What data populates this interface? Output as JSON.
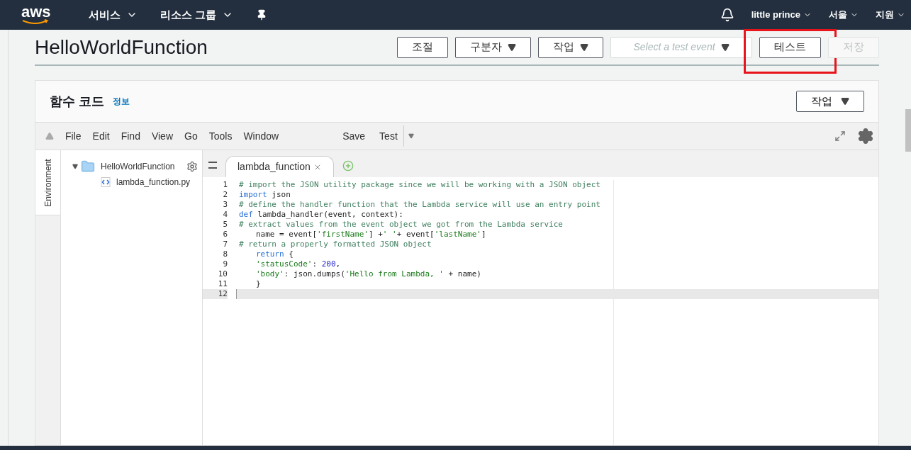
{
  "nav": {
    "logo": "aws",
    "menus": [
      {
        "label": "서비스"
      },
      {
        "label": "리소스 그룹"
      }
    ],
    "right": [
      {
        "label": "little prince"
      },
      {
        "label": "서울"
      },
      {
        "label": "지원"
      }
    ]
  },
  "header": {
    "title": "HelloWorldFunction",
    "buttons": [
      {
        "label": "조절",
        "kind": "plain",
        "disabled": false,
        "highlighted": false
      },
      {
        "label": "구분자",
        "kind": "dropdown",
        "disabled": false,
        "highlighted": false
      },
      {
        "label": "작업",
        "kind": "dropdown",
        "disabled": false,
        "highlighted": false
      },
      {
        "placeholder": "Select a test event",
        "kind": "select",
        "highlighted": false
      },
      {
        "label": "테스트",
        "kind": "plain",
        "disabled": false,
        "highlighted": true
      },
      {
        "label": "저장",
        "kind": "plain",
        "disabled": true,
        "highlighted": false
      }
    ]
  },
  "panel": {
    "title": "함수 코드",
    "info_link": "정보",
    "action_button": "작업"
  },
  "ide": {
    "menu": [
      "File",
      "Edit",
      "Find",
      "View",
      "Go",
      "Tools",
      "Window"
    ],
    "save": "Save",
    "test": "Test",
    "side_tab": "Environment",
    "tree": [
      {
        "label": "HelloWorldFunction",
        "kind": "folder",
        "expanded": true,
        "children": [
          {
            "label": "lambda_function.py",
            "kind": "file"
          }
        ]
      }
    ],
    "tabs": [
      {
        "label": "lambda_function",
        "selected": true
      }
    ],
    "lines": [
      {
        "n": "1",
        "tokens": [
          {
            "kind": "comment",
            "text": "# import the JSON utility package since we will be working with a JSON object"
          }
        ]
      },
      {
        "n": "2",
        "tokens": [
          {
            "kind": "keyword",
            "text": "import"
          },
          {
            "kind": "plain",
            "text": " json"
          }
        ]
      },
      {
        "n": "3",
        "tokens": [
          {
            "kind": "comment",
            "text": "# define the handler function that the Lambda service will use an entry point"
          }
        ]
      },
      {
        "n": "4",
        "tokens": [
          {
            "kind": "keyword",
            "text": "def"
          },
          {
            "kind": "plain",
            "text": " lambda_handler(event, context):"
          }
        ]
      },
      {
        "n": "5",
        "tokens": [
          {
            "kind": "comment",
            "text": "# extract values from the event object we got from the Lambda service"
          }
        ]
      },
      {
        "n": "6",
        "indented": true,
        "tokens": [
          {
            "kind": "plain",
            "text": "name = event["
          },
          {
            "kind": "string",
            "text": "'firstName'"
          },
          {
            "kind": "plain",
            "text": "] +"
          },
          {
            "kind": "string",
            "text": "' '"
          },
          {
            "kind": "plain",
            "text": "+ event["
          },
          {
            "kind": "string",
            "text": "'lastName'"
          },
          {
            "kind": "plain",
            "text": "]"
          }
        ]
      },
      {
        "n": "7",
        "tokens": [
          {
            "kind": "comment",
            "text": "# return a properly formatted JSON object"
          }
        ]
      },
      {
        "n": "8",
        "indented": true,
        "tokens": [
          {
            "kind": "keyword",
            "text": "return"
          },
          {
            "kind": "plain",
            "text": " {"
          }
        ]
      },
      {
        "n": "9",
        "indented": true,
        "tokens": [
          {
            "kind": "string",
            "text": "'statusCode'"
          },
          {
            "kind": "plain",
            "text": ": "
          },
          {
            "kind": "number",
            "text": "200"
          },
          {
            "kind": "plain",
            "text": ","
          }
        ]
      },
      {
        "n": "10",
        "indented": true,
        "tokens": [
          {
            "kind": "string",
            "text": "'body'"
          },
          {
            "kind": "plain",
            "text": ": json.dumps("
          },
          {
            "kind": "string",
            "text": "'Hello from Lambda, '"
          },
          {
            "kind": "plain",
            "text": " + name)"
          }
        ]
      },
      {
        "n": "11",
        "indented": true,
        "tokens": [
          {
            "kind": "plain",
            "text": "}"
          }
        ]
      },
      {
        "n": "12",
        "selected": true
      }
    ]
  }
}
